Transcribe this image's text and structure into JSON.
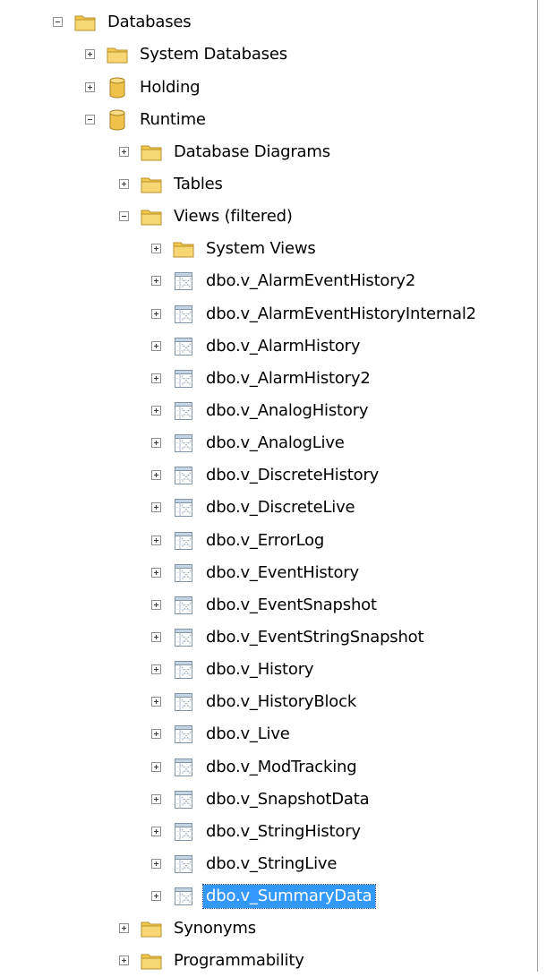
{
  "colors": {
    "selection": "#3399ff",
    "folder": "#f2c94c",
    "database": "#f0c14b"
  },
  "tree": {
    "root": {
      "label": "Databases",
      "icon": "folder-icon",
      "state": "expanded"
    },
    "nodes": [
      {
        "label": "System Databases",
        "icon": "folder-icon",
        "state": "collapsed"
      },
      {
        "label": "Holding",
        "icon": "database-icon",
        "state": "collapsed"
      },
      {
        "label": "Runtime",
        "icon": "database-icon",
        "state": "expanded"
      },
      {
        "label": "Database Diagrams",
        "icon": "folder-icon",
        "state": "collapsed"
      },
      {
        "label": "Tables",
        "icon": "folder-icon",
        "state": "collapsed"
      },
      {
        "label": "Views (filtered)",
        "icon": "folder-icon",
        "state": "expanded"
      },
      {
        "label": "System Views",
        "icon": "folder-icon",
        "state": "collapsed"
      },
      {
        "label": "dbo.v_AlarmEventHistory2",
        "icon": "view-icon",
        "state": "collapsed"
      },
      {
        "label": "dbo.v_AlarmEventHistoryInternal2",
        "icon": "view-icon",
        "state": "collapsed"
      },
      {
        "label": "dbo.v_AlarmHistory",
        "icon": "view-icon",
        "state": "collapsed"
      },
      {
        "label": "dbo.v_AlarmHistory2",
        "icon": "view-icon",
        "state": "collapsed"
      },
      {
        "label": "dbo.v_AnalogHistory",
        "icon": "view-icon",
        "state": "collapsed"
      },
      {
        "label": "dbo.v_AnalogLive",
        "icon": "view-icon",
        "state": "collapsed"
      },
      {
        "label": "dbo.v_DiscreteHistory",
        "icon": "view-icon",
        "state": "collapsed"
      },
      {
        "label": "dbo.v_DiscreteLive",
        "icon": "view-icon",
        "state": "collapsed"
      },
      {
        "label": "dbo.v_ErrorLog",
        "icon": "view-icon",
        "state": "collapsed"
      },
      {
        "label": "dbo.v_EventHistory",
        "icon": "view-icon",
        "state": "collapsed"
      },
      {
        "label": "dbo.v_EventSnapshot",
        "icon": "view-icon",
        "state": "collapsed"
      },
      {
        "label": "dbo.v_EventStringSnapshot",
        "icon": "view-icon",
        "state": "collapsed"
      },
      {
        "label": "dbo.v_History",
        "icon": "view-icon",
        "state": "collapsed"
      },
      {
        "label": "dbo.v_HistoryBlock",
        "icon": "view-icon",
        "state": "collapsed"
      },
      {
        "label": "dbo.v_Live",
        "icon": "view-icon",
        "state": "collapsed"
      },
      {
        "label": "dbo.v_ModTracking",
        "icon": "view-icon",
        "state": "collapsed"
      },
      {
        "label": "dbo.v_SnapshotData",
        "icon": "view-icon",
        "state": "collapsed"
      },
      {
        "label": "dbo.v_StringHistory",
        "icon": "view-icon",
        "state": "collapsed"
      },
      {
        "label": "dbo.v_StringLive",
        "icon": "view-icon",
        "state": "collapsed"
      },
      {
        "label": "dbo.v_SummaryData",
        "icon": "view-icon",
        "state": "collapsed",
        "selected": true
      },
      {
        "label": "Synonyms",
        "icon": "folder-icon",
        "state": "collapsed"
      },
      {
        "label": "Programmability",
        "icon": "folder-icon",
        "state": "collapsed"
      }
    ]
  }
}
